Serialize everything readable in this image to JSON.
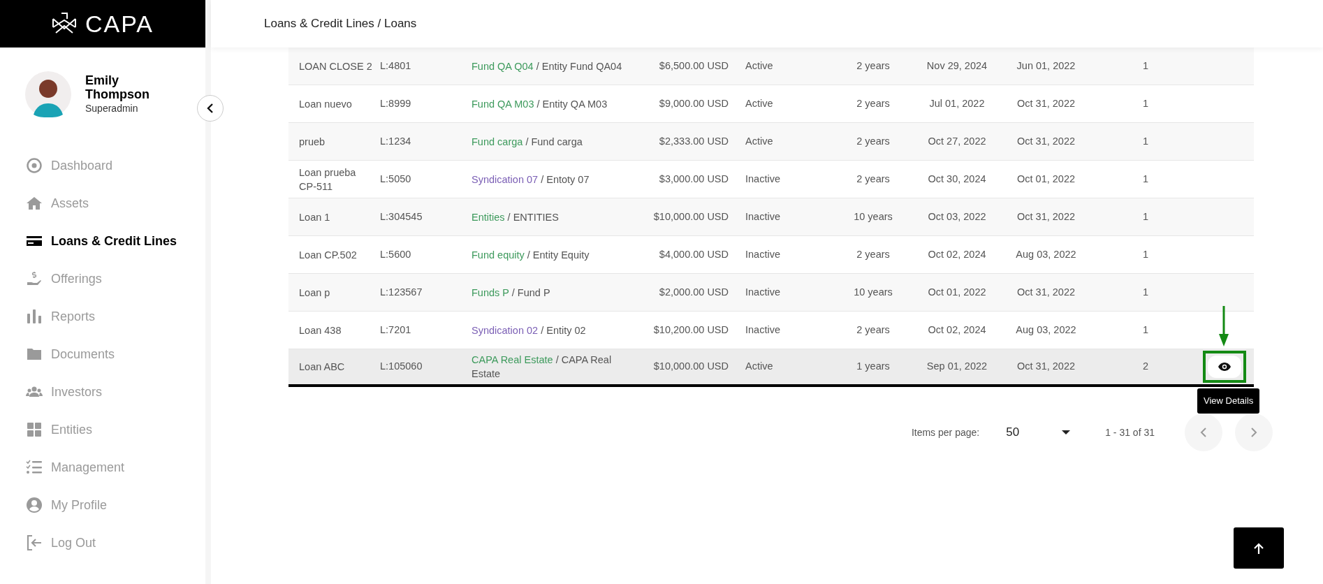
{
  "logo": {
    "text": "CAPA"
  },
  "breadcrumb": "Loans & Credit Lines / Loans",
  "user": {
    "name": "Emily Thompson",
    "role": "Superadmin"
  },
  "sidebar": {
    "items": [
      {
        "label": "Dashboard",
        "selected": false
      },
      {
        "label": "Assets",
        "selected": false
      },
      {
        "label": "Loans & Credit Lines",
        "selected": true
      },
      {
        "label": "Offerings",
        "selected": false
      },
      {
        "label": "Reports",
        "selected": false
      },
      {
        "label": "Documents",
        "selected": false
      },
      {
        "label": "Investors",
        "selected": false
      },
      {
        "label": "Entities",
        "selected": false
      },
      {
        "label": "Management",
        "selected": false
      },
      {
        "label": "My Profile",
        "selected": false
      },
      {
        "label": "Log Out",
        "selected": false
      }
    ]
  },
  "table": {
    "rows": [
      {
        "name": "LOAN CLOSE 2",
        "code": "L:4801",
        "fund": "Fund QA Q04",
        "color": "#3d9a5c",
        "entity": "/ Entity Fund QA04",
        "amount": "$6,500.00 USD",
        "status": "Active",
        "term": "2 years",
        "date_1": "Nov 29, 2024",
        "date_2": "Jun 01, 2022",
        "count": "1",
        "highlighted": false
      },
      {
        "name": "Loan nuevo",
        "code": "L:8999",
        "fund": "Fund QA M03",
        "color": "#3d9a5c",
        "entity": "/ Entity QA M03",
        "amount": "$9,000.00 USD",
        "status": "Active",
        "term": "2 years",
        "date_1": "Jul 01, 2022",
        "date_2": "Oct 31, 2022",
        "count": "1",
        "highlighted": false
      },
      {
        "name": "prueb",
        "code": "L:1234",
        "fund": "Fund carga",
        "color": "#3d9a5c",
        "entity": "/ Fund carga",
        "amount": "$2,333.00 USD",
        "status": "Active",
        "term": "2 years",
        "date_1": "Oct 27, 2022",
        "date_2": "Oct 31, 2022",
        "count": "1",
        "highlighted": false
      },
      {
        "name": "Loan prueba CP-511",
        "code": "L:5050",
        "fund": "Syndication 07",
        "color": "#7b5fb5",
        "entity": "/ Entoty 07",
        "amount": "$3,000.00 USD",
        "status": "Inactive",
        "term": "2 years",
        "date_1": "Oct 30, 2024",
        "date_2": "Oct 01, 2022",
        "count": "1",
        "highlighted": false
      },
      {
        "name": "Loan 1",
        "code": "L:304545",
        "fund": "Entities",
        "color": "#3d9a5c",
        "entity": "/ ENTITIES",
        "amount": "$10,000.00 USD",
        "status": "Inactive",
        "term": "10 years",
        "date_1": "Oct 03, 2022",
        "date_2": "Oct 31, 2022",
        "count": "1",
        "highlighted": false
      },
      {
        "name": "Loan CP.502",
        "code": "L:5600",
        "fund": "Fund equity",
        "color": "#3d9a5c",
        "entity": "/ Entity Equity",
        "amount": "$4,000.00 USD",
        "status": "Inactive",
        "term": "2 years",
        "date_1": "Oct 02, 2024",
        "date_2": "Aug 03, 2022",
        "count": "1",
        "highlighted": false
      },
      {
        "name": "Loan p",
        "code": "L:123567",
        "fund": "Funds P",
        "color": "#3d9a5c",
        "entity": "/ Fund P",
        "amount": "$2,000.00 USD",
        "status": "Inactive",
        "term": "10 years",
        "date_1": "Oct 01, 2022",
        "date_2": "Oct 31, 2022",
        "count": "1",
        "highlighted": false
      },
      {
        "name": "Loan 438",
        "code": "L:7201",
        "fund": "Syndication 02",
        "color": "#7b5fb5",
        "entity": "/ Entity 02",
        "amount": "$10,200.00 USD",
        "status": "Inactive",
        "term": "2 years",
        "date_1": "Oct 02, 2024",
        "date_2": "Aug 03, 2022",
        "count": "1",
        "highlighted": false
      },
      {
        "name": "Loan ABC",
        "code": "L:105060",
        "fund": "CAPA Real Estate",
        "color": "#3d9a5c",
        "entity": "/ CAPA Real Estate",
        "amount": "$10,000.00 USD",
        "status": "Active",
        "term": "1 years",
        "date_1": "Sep 01, 2022",
        "date_2": "Oct 31, 2022",
        "count": "2",
        "highlighted": true
      }
    ]
  },
  "tooltip": "View Details",
  "pagination": {
    "label": "Items per page:",
    "page_size": "50",
    "range": "1 - 31 of 31"
  }
}
